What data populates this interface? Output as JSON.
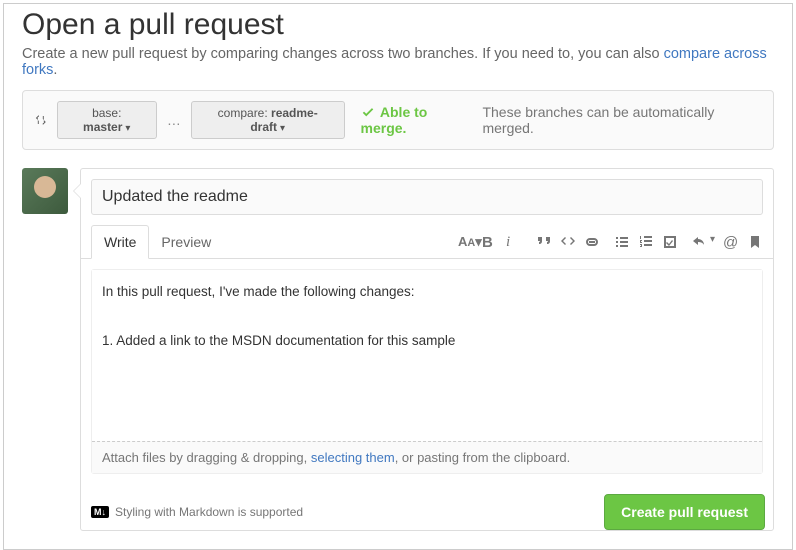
{
  "header": {
    "title": "Open a pull request",
    "subhead_text": "Create a new pull request by comparing changes across two branches. If you need to, you can also ",
    "subhead_link": "compare across forks"
  },
  "branchbar": {
    "base_label": "base: ",
    "base_branch": "master",
    "compare_label": "compare: ",
    "compare_branch": "readme-draft",
    "merge_ok": "Able to merge.",
    "merge_tail": "These branches can be automatically merged."
  },
  "form": {
    "title_value": "Updated the readme",
    "tabs": {
      "write": "Write",
      "preview": "Preview"
    },
    "description": "In this pull request, I've made the following changes:\n\n1. Added a link to the MSDN documentation for this sample",
    "attach_prefix": "Attach files by dragging & dropping, ",
    "attach_link": "selecting them",
    "attach_suffix": ", or pasting from the clipboard.",
    "markdown_note": "Styling with Markdown is supported",
    "submit_label": "Create pull request"
  },
  "icons": {
    "compare": "compare-icon",
    "check": "check-icon",
    "text_size": "AA",
    "bold": "B",
    "italic": "i",
    "quote": "quote-icon",
    "code": "code-icon",
    "link": "link-icon",
    "ul": "ul-icon",
    "ol": "ol-icon",
    "task": "task-icon",
    "reply": "reply-icon",
    "mention": "@",
    "bookmark": "bookmark-icon",
    "markdown": "M↓"
  }
}
